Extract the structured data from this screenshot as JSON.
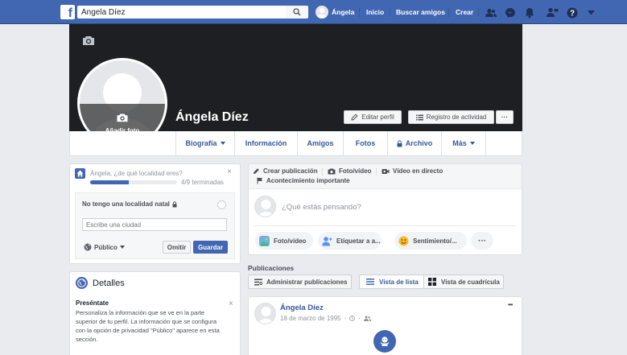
{
  "topbar": {
    "logo": "f",
    "search_value": "Ángela Díez",
    "user_name": "Ángela",
    "nav_links": [
      "Inicio",
      "Buscar amigos",
      "Crear"
    ],
    "icons": [
      "friends-icon",
      "messenger-icon",
      "notifications-icon",
      "quick-help-icon",
      "help-icon",
      "menu-arrow-icon"
    ]
  },
  "profile": {
    "name": "Ángela Díez",
    "add_photo_label": "Añadir foto",
    "edit_profile": "Editar perfil",
    "activity_log": "Registro de actividad",
    "more_dots": "···"
  },
  "tabs": [
    "Biografía",
    "Información",
    "Amigos",
    "Fotos",
    "Archivo",
    "Más"
  ],
  "location_card": {
    "question": "Ángela, ¿de qué localidad eres?",
    "progress_text": "4/9 terminadas",
    "progress_fraction": 0.444,
    "option_label": "No tengo una localidad natal",
    "city_placeholder": "Escribe una ciudad",
    "privacy_label": "Público",
    "skip_label": "Omitir",
    "save_label": "Guardar"
  },
  "details_card": {
    "title": "Detalles",
    "intro_title": "Preséntate",
    "intro_lines": [
      "Personaliza la información que se ve en la parte",
      "superior de tu perfil. La información que se configura",
      "con la opción de privacidad \"Público\" aparece en esta",
      "sección."
    ]
  },
  "composer": {
    "tabs": [
      "Crear publicación",
      "Foto/vídeo",
      "Vídeo en directo"
    ],
    "life_event": "Acontecimiento importante",
    "placeholder": "¿Qué estás pensando?",
    "actions": [
      "Foto/vídeo",
      "Etiquetar a a...",
      "Sentimiento/..."
    ],
    "more": "···"
  },
  "posts": {
    "header": "Publicaciones",
    "manage": "Administrar publicaciones",
    "list_view": "Vista de lista",
    "grid_view": "Vista de cuadrícula"
  },
  "post": {
    "author": "Ángela Díez",
    "date": "18 de marzo de 1995",
    "date_separator": "·",
    "more": "•••"
  },
  "colors": {
    "brand_blue": "#4267b2",
    "cover": "#1d1f22",
    "background": "#e9ebee",
    "link": "#365899"
  }
}
